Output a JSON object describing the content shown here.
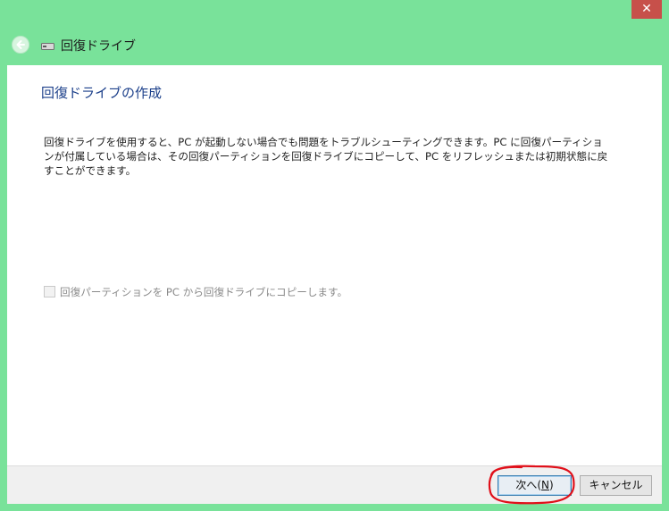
{
  "window": {
    "title": "回復ドライブ",
    "close_glyph": "✕",
    "accent_color": "#79e29a"
  },
  "page": {
    "heading": "回復ドライブの作成",
    "description_lines": [
      "回復ドライブを使用すると、PC が起動しない場合でも問題をトラブルシューティングできます。PC に回復パーティショ",
      "ンが付属している場合は、その回復パーティションを回復ドライブにコピーして、PC をリフレッシュまたは初期状態に戻",
      "すことができます。"
    ],
    "checkbox": {
      "label": "回復パーティションを PC から回復ドライブにコピーします。",
      "checked": false,
      "enabled": false
    }
  },
  "footer": {
    "next_label": "次へ(N)",
    "next_prefix": "次へ(",
    "next_mnemonic": "N",
    "next_suffix": ")",
    "cancel_label": "キャンセル"
  },
  "icons": {
    "back": "back-arrow-icon",
    "drive": "usb-drive-icon",
    "close": "close-icon"
  },
  "annotation_color": "#e0101a"
}
